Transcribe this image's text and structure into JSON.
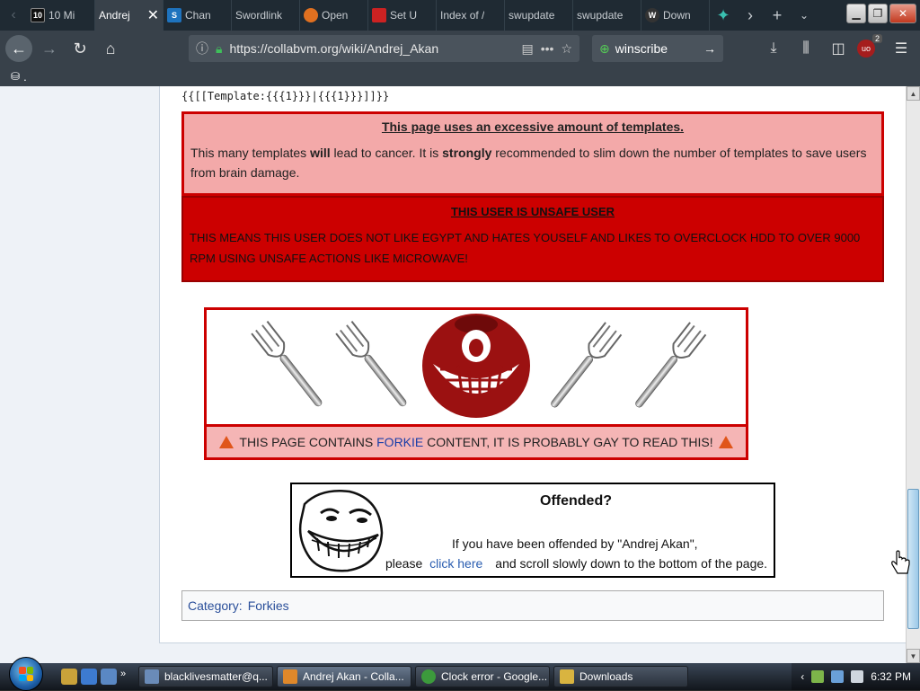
{
  "tabs": [
    {
      "title": "10 Mi",
      "icon_text": "10",
      "icon_color": "#111111"
    },
    {
      "title": "Andrej",
      "icon_text": "",
      "icon_color": "",
      "active": true
    },
    {
      "title": "Chan",
      "icon_text": "S",
      "icon_color": "#1e73be"
    },
    {
      "title": "Swordlink",
      "icon_text": "",
      "icon_color": ""
    },
    {
      "title": "Open",
      "icon_text": "",
      "icon_color": "#e07020"
    },
    {
      "title": "Set U",
      "icon_text": "",
      "icon_color": "#cc2222"
    },
    {
      "title": "Index of /",
      "icon_text": "",
      "icon_color": ""
    },
    {
      "title": "swupdate",
      "icon_text": "",
      "icon_color": ""
    },
    {
      "title": "swupdate",
      "icon_text": "",
      "icon_color": ""
    },
    {
      "title": "Down",
      "icon_text": "W",
      "icon_color": "#333333"
    }
  ],
  "nav": {
    "url": "https://collabvm.org/wiki/Andrej_Akan",
    "search_value": "winscribe",
    "ublock_count": "2"
  },
  "bookmarks": {
    "label": "."
  },
  "page": {
    "template_source": "{{[[Template:{{{1}}}|{{{1}}}]]}}",
    "templates_box": {
      "heading": "This page uses an excessive amount of templates.",
      "text_1": "This many templates ",
      "text_bold_1": "will",
      "text_2": " lead to cancer. It is ",
      "text_bold_2": "strongly",
      "text_3": " recommended to slim down the number of templates to save users from brain damage."
    },
    "unsafe_box": {
      "heading": "THIS USER IS UNSAFE USER",
      "text": "THIS MEANS THIS USER DOES NOT LIKE EGYPT AND HATES YOUSELF AND LIKES TO OVERCLOCK HDD TO OVER 9000 RPM USING UNSAFE ACTIONS LIKE MICROWAVE!"
    },
    "forkie_box": {
      "text_1": "THIS PAGE CONTAINS ",
      "link": "FORKIE",
      "text_2": " CONTENT, IT IS PROBABLY GAY TO READ THIS!"
    },
    "offended_box": {
      "title": "Offended?",
      "line1": "If you have been offended by \"Andrej Akan\",",
      "line2_a": "please",
      "link": "click here",
      "line2_b": "and scroll slowly down to the bottom of the page."
    },
    "category": {
      "label": "Category:",
      "link": "Forkies"
    }
  },
  "taskbar": {
    "items": [
      {
        "label": "blacklivesmatter@q...",
        "color": "#6a8bb8"
      },
      {
        "label": "Andrej Akan - Colla...",
        "color": "#e0882a",
        "active": true
      },
      {
        "label": "Clock error - Google...",
        "color": "#3c9a3c"
      },
      {
        "label": "Downloads",
        "color": "#d9b440"
      }
    ],
    "time": "6:32 PM"
  }
}
